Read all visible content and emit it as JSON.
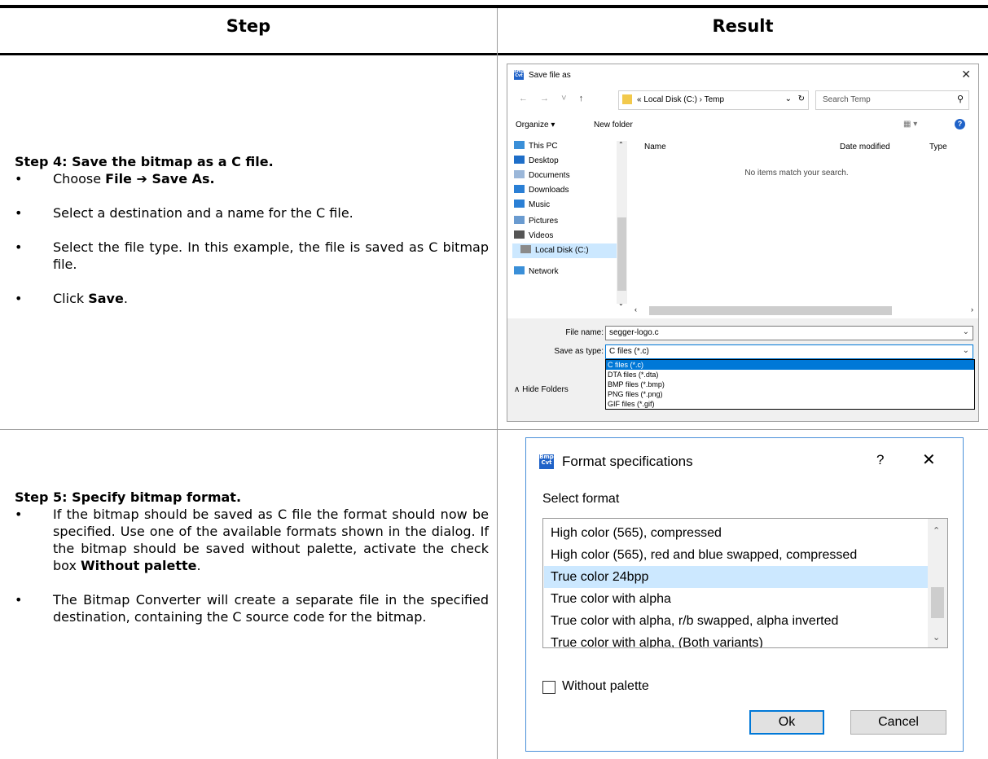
{
  "headers": {
    "step": "Step",
    "result": "Result"
  },
  "step4": {
    "heading": "Step 4: Save the bitmap as a C file.",
    "b1_pre": "Choose ",
    "b1_bold": "File ➔ Save As.",
    "b2": "Select a destination and a name for the C file.",
    "b3": "Select the file type. In this example, the file is saved as C bitmap file.",
    "b4_pre": "Click ",
    "b4_bold": "Save",
    "b4_post": "."
  },
  "step5": {
    "heading": "Step 5: Specify bitmap format.",
    "b1_pre": "If the bitmap should be saved as C file the format should now be specified. Use one of the available formats shown in the dialog. If the bitmap should be saved without palette, activate the check box ",
    "b1_bold": "Without palette",
    "b1_post": ".",
    "b2": "The Bitmap Converter will create a separate file in the specified destination, containing the C source code for the bitmap."
  },
  "save_dialog": {
    "icon_text": "Bmp Cvt",
    "title": "Save file as",
    "close": "✕",
    "nav_arrows": "← → ˅",
    "nav_up": "↑",
    "address": "«  Local Disk (C:)  ›  Temp",
    "refresh": "↻",
    "search_placeholder": "Search Temp",
    "organize": "Organize ▾",
    "new_folder": "New folder",
    "help": "?",
    "nav_items": [
      {
        "label": "This PC",
        "color": "#3a8fd8"
      },
      {
        "label": "Desktop",
        "color": "#1e6ec8"
      },
      {
        "label": "Documents",
        "color": "#9bb7d9"
      },
      {
        "label": "Downloads",
        "color": "#2a7fd5"
      },
      {
        "label": "Music",
        "color": "#2a7fd5"
      },
      {
        "label": "Pictures",
        "color": "#6a9bd0"
      },
      {
        "label": "Videos",
        "color": "#555555"
      },
      {
        "label": "Local Disk (C:)",
        "color": "#8a8a8a"
      },
      {
        "label": "Network",
        "color": "#3a8fd8"
      }
    ],
    "col_name": "Name",
    "col_date": "Date modified",
    "col_type": "Type",
    "empty_message": "No items match your search.",
    "file_name_label": "File name:",
    "file_name_value": "segger-logo.c",
    "save_type_label": "Save as type:",
    "save_type_value": "C files (*.c)",
    "type_options": [
      "C files (*.c)",
      "DTA files (*.dta)",
      "BMP files (*.bmp)",
      "PNG files (*.png)",
      "GIF files (*.gif)"
    ],
    "hide_folders": "∧  Hide Folders"
  },
  "format_dialog": {
    "icon_text": "Bmp Cvt",
    "title": "Format specifications",
    "help": "?",
    "close": "✕",
    "select_label": "Select format",
    "items": [
      "High color (565), compressed",
      "High color (565), red and blue swapped, compressed",
      "True color 24bpp",
      "True color with alpha",
      "True color with alpha, r/b swapped, alpha inverted",
      "True color with alpha, (Both variants)"
    ],
    "selected_index": 2,
    "checkbox_label": "Without palette",
    "ok": "Ok",
    "cancel": "Cancel"
  }
}
